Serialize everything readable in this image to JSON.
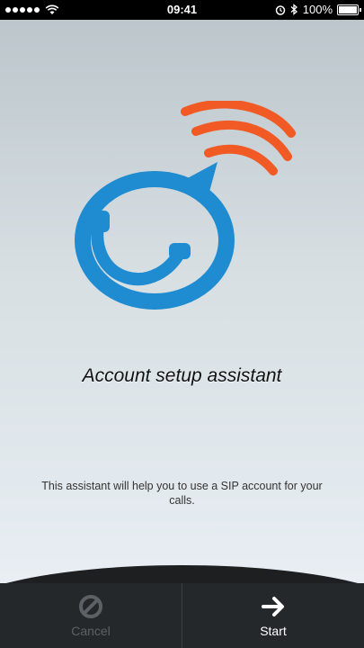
{
  "status_bar": {
    "time": "09:41",
    "battery": "100%"
  },
  "main": {
    "title": "Account setup assistant",
    "description": "This assistant will help you to use a SIP account for your calls."
  },
  "toolbar": {
    "cancel_label": "Cancel",
    "start_label": "Start"
  },
  "icons": {
    "cancel": "cancel-icon",
    "start": "arrow-right-icon",
    "logo": "chat-phone-logo"
  },
  "colors": {
    "logo_blue": "#1f8bd0",
    "logo_orange": "#f15a24",
    "toolbar_bg": "#25282b"
  }
}
